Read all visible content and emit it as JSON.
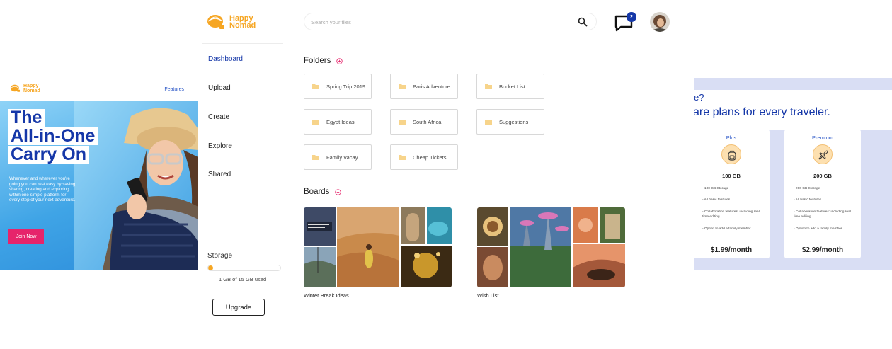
{
  "brand": {
    "name_line1": "Happy",
    "name_line2": "Nomad",
    "color": "#f6a623",
    "accent": "#1537a8"
  },
  "landing": {
    "nav_link": "Features",
    "hero_lines": [
      "The",
      "All-in-One",
      "Carry On"
    ],
    "hero_body": "Whenever and wherever you're going you can rest easy by saving, sharing, creating and exploring within one simple platform for every step of your next adventure.",
    "cta": "Join Now"
  },
  "sidebar": {
    "items": [
      {
        "label": "Dashboard",
        "active": true
      },
      {
        "label": "Upload",
        "active": false
      },
      {
        "label": "Create",
        "active": false
      },
      {
        "label": "Explore",
        "active": false
      },
      {
        "label": "Shared",
        "active": false
      }
    ],
    "storage_title": "Storage",
    "storage_used_fraction": 0.0667,
    "storage_text": "1 GB of 15 GB used",
    "upgrade_label": "Upgrade"
  },
  "header": {
    "search_placeholder": "Search your files",
    "notification_count": "2"
  },
  "folders": {
    "title": "Folders",
    "items": [
      "Spring Trip 2019",
      "Paris Adventure",
      "Bucket List",
      "Egypt Ideas",
      "South Africa",
      "Suggestions",
      "Family Vacay",
      "Cheap Tickets"
    ]
  },
  "boards": {
    "title": "Boards",
    "items": [
      {
        "label": "Winter Break Ideas"
      },
      {
        "label": "Wish List"
      }
    ]
  },
  "pricing": {
    "question_fragment": "e?",
    "headline": "are plans for every  traveler.",
    "plans": [
      {
        "name": "Plus",
        "icon": "backpack-icon",
        "storage": "100 GB",
        "features": [
          "- 100 GB Storage",
          "- All basic features",
          "- Collaboration features: including real time editing",
          "- Option to add a family member"
        ],
        "price": "$1.99/month"
      },
      {
        "name": "Premium",
        "icon": "airplane-icon",
        "storage": "200 GB",
        "features": [
          "- 200 GB Storage",
          "- All basic features",
          "- Collaboration features: including real time editing",
          "- Option to add a family member"
        ],
        "price": "$2.99/month"
      }
    ]
  }
}
